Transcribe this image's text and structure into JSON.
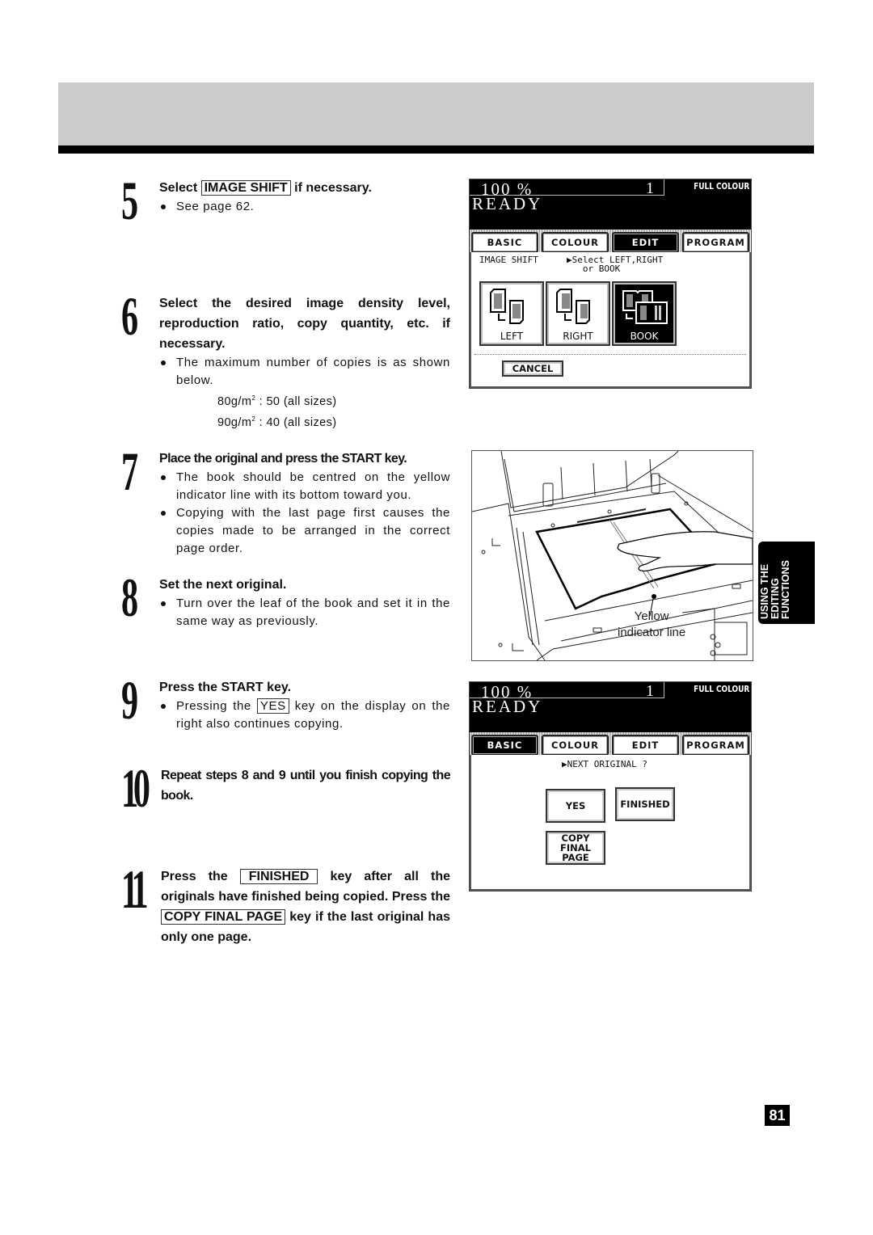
{
  "steps": [
    {
      "number": "5",
      "title_parts": [
        "Select ",
        "IMAGE SHIFT",
        " if necessary."
      ],
      "bullets": [
        "See page 62."
      ]
    },
    {
      "number": "6",
      "title": "Select the desired image density level, reproduction ratio, copy quantity, etc. if necessary.",
      "bullets": [
        "The maximum number of copies is as shown below."
      ],
      "specs": [
        {
          "weight": "80g/m",
          "sup": "2",
          "value": " : 50 (all sizes)"
        },
        {
          "weight": "90g/m",
          "sup": "2",
          "value": " : 40 (all sizes)"
        }
      ]
    },
    {
      "number": "7",
      "title": "Place the original and press the START key.",
      "bullets": [
        "The book should be centred on the yellow indicator line with its bottom toward you.",
        "Copying with the last page first causes the copies made to be arranged in the correct page order."
      ]
    },
    {
      "number": "8",
      "title": "Set the next original.",
      "bullets": [
        "Turn over the leaf of the book and set it in the same way as previously."
      ]
    },
    {
      "number": "9",
      "title": "Press the START key.",
      "bullet_parts": [
        "Pressing the ",
        "YES",
        " key on the display on the right also continues copying."
      ]
    },
    {
      "number": "10",
      "title": "Repeat steps 8 and 9 until you finish copying the book."
    },
    {
      "number": "11",
      "title_parts": [
        "Press the ",
        "FINISHED",
        " key after all the originals have finished being copied. Press the ",
        "COPY FINAL PAGE",
        " key if the last original has only one page."
      ]
    }
  ],
  "panel1": {
    "ratio": "100  %",
    "quantity": "1",
    "mode": "FULL COLOUR",
    "status": "READY",
    "tabs": [
      "BASIC",
      "COLOUR",
      "EDIT",
      "PROGRAM"
    ],
    "active_tab": "EDIT",
    "function_label": "IMAGE SHIFT",
    "prompt": "▶Select LEFT,RIGHT\n   or BOOK",
    "options": [
      {
        "label": "LEFT",
        "icon": "shift-left-icon"
      },
      {
        "label": "RIGHT",
        "icon": "shift-right-icon"
      },
      {
        "label": "BOOK",
        "icon": "book-shift-icon",
        "selected": true
      }
    ],
    "cancel": "CANCEL"
  },
  "illustration": {
    "caption_line1": "Yellow",
    "caption_line2": "indicator line"
  },
  "panel2": {
    "ratio": "100  %",
    "quantity": "1",
    "mode": "FULL COLOUR",
    "status": "READY",
    "tabs": [
      "BASIC",
      "COLOUR",
      "EDIT",
      "PROGRAM"
    ],
    "active_tab": "BASIC",
    "prompt": "▶NEXT ORIGINAL ?",
    "yes": "YES",
    "finished": "FINISHED",
    "copy_final_page": "COPY\nFINAL\nPAGE"
  },
  "side_tab": "USING THE\nEDITING\nFUNCTIONS",
  "page_number": "81"
}
